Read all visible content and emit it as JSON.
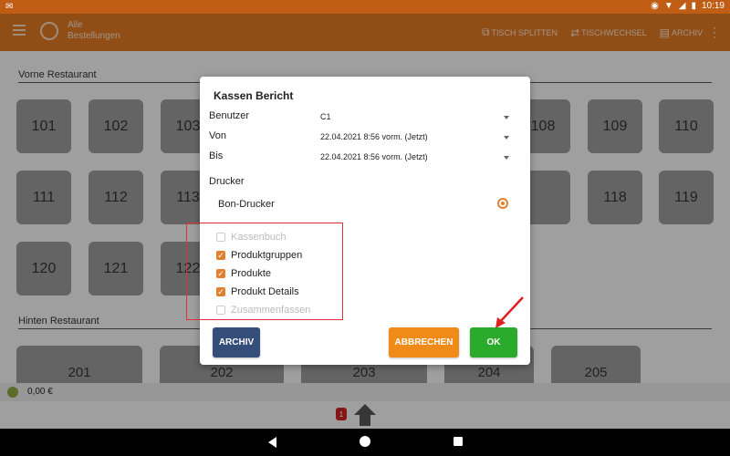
{
  "status": {
    "time": "10:19"
  },
  "appbar": {
    "title_line1": "Alle",
    "title_line2": "Bestellungen",
    "actions": [
      {
        "label": "TISCH SPLITTEN"
      },
      {
        "label": "TISCHWECHSEL"
      },
      {
        "label": "ARCHIV"
      }
    ]
  },
  "sections": {
    "vorne": "Vorne Restaurant",
    "hinten": "Hinten Restaurant"
  },
  "tables": {
    "vorne_row1": [
      "101",
      "102",
      "103",
      "108",
      "109",
      "110"
    ],
    "vorne_row2": [
      "111",
      "112",
      "113",
      "118",
      "119"
    ],
    "vorne_row3": [
      "120",
      "121",
      "122"
    ],
    "hinten": [
      "201",
      "202",
      "203",
      "204",
      "205"
    ]
  },
  "footer": {
    "amount": "0,00 €",
    "badge_count": "1"
  },
  "dialog": {
    "title": "Kassen Bericht",
    "user": {
      "label": "Benutzer",
      "value": "C1"
    },
    "from": {
      "label": "Von",
      "value": "22.04.2021 8:56 vorm. (Jetzt)"
    },
    "to": {
      "label": "Bis",
      "value": "22.04.2021 8:56 vorm. (Jetzt)"
    },
    "printer_section": "Drucker",
    "printer": "Bon-Drucker",
    "options": [
      {
        "label": "Kassenbuch",
        "checked": false,
        "enabled": false
      },
      {
        "label": "Produktgruppen",
        "checked": true,
        "enabled": true
      },
      {
        "label": "Produkte",
        "checked": true,
        "enabled": true
      },
      {
        "label": "Produkt Details",
        "checked": true,
        "enabled": true
      },
      {
        "label": "Zusammenfassen",
        "checked": false,
        "enabled": false
      }
    ],
    "buttons": {
      "archiv": "ARCHIV",
      "cancel": "ABBRECHEN",
      "ok": "OK"
    }
  },
  "colors": {
    "accent": "#dd7722",
    "ok": "#2bab2b",
    "cancel": "#f08b1a",
    "archiv": "#344e7a",
    "highlight": "#dd3333"
  }
}
